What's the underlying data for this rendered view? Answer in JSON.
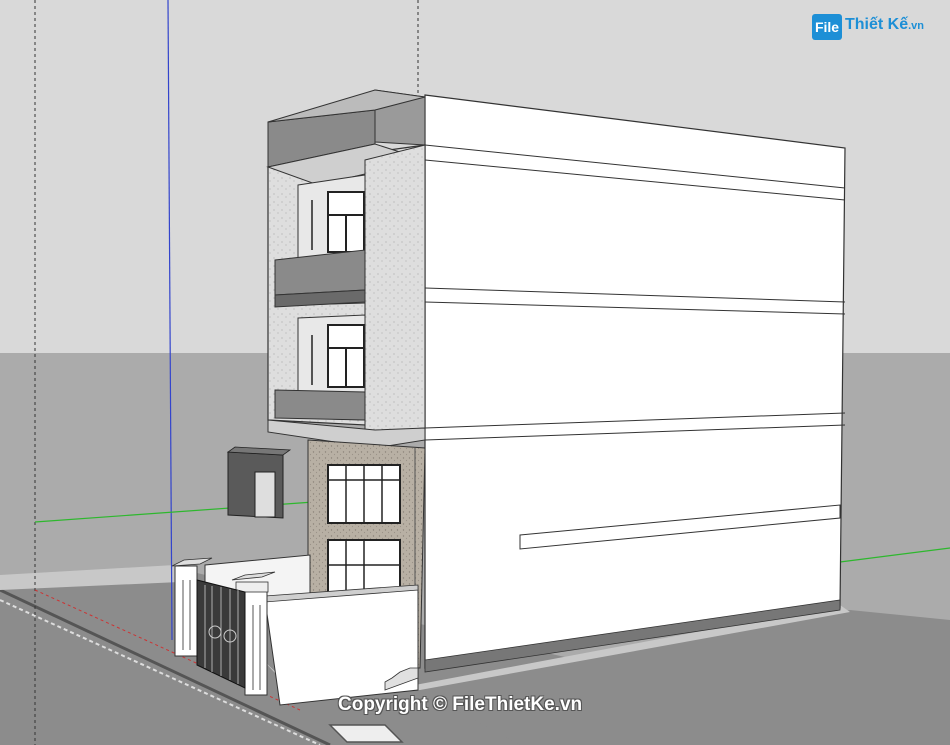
{
  "watermark": {
    "logo_badge": "File",
    "logo_name": "Thiết Kế",
    "logo_domain": ".vn",
    "copyright": "Copyright © FileThietKe.vn"
  },
  "colors": {
    "sky": "#d9d9d9",
    "ground": "#ababab",
    "road": "#8c8c8c",
    "wall": "#ffffff",
    "glass": "#8a8a8a",
    "stone": "#d6d6d6",
    "axis_blue": "#3344cc",
    "axis_green": "#2db82d",
    "axis_red": "#cc3333",
    "brand_blue": "#1d8fd6"
  },
  "scene": {
    "model": "house-3d-model",
    "axes": [
      "blue-axis",
      "green-axis",
      "red-axis"
    ]
  }
}
